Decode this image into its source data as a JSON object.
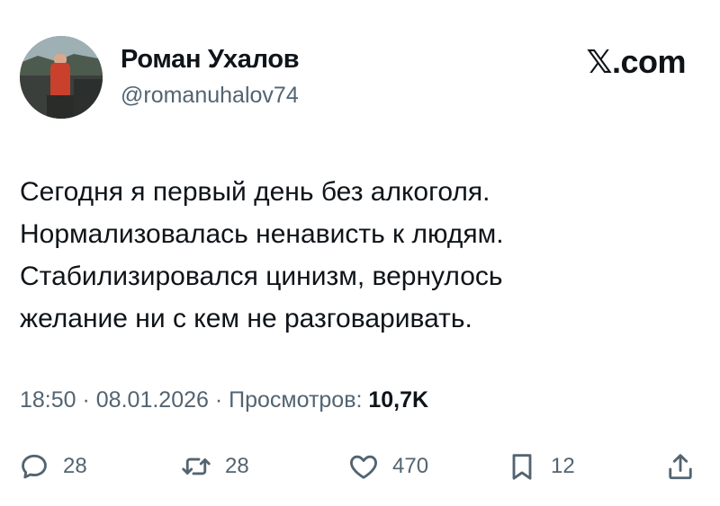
{
  "author": {
    "name": "Роман Ухалов",
    "handle": "@romanuhalov74"
  },
  "brand": "𝕏.com",
  "body_lines": [
    "Сегодня я первый день без алкоголя.",
    "Нормализовалась ненависть к людям.",
    "Стабилизировался цинизм, вернулось",
    "желание ни с кем не разговаривать."
  ],
  "meta": {
    "time": "18:50",
    "sep1": " · ",
    "date": "08.01.2026",
    "sep2": " · ",
    "views_label": "Просмотров: ",
    "views_count": "10,7K"
  },
  "actions": {
    "replies": "28",
    "reposts": "28",
    "likes": "470",
    "bookmarks": "12"
  },
  "icons": [
    "reply-icon",
    "repost-icon",
    "like-icon",
    "bookmark-icon",
    "share-icon"
  ],
  "colors": {
    "text": "#0f1419",
    "secondary": "#536471",
    "background": "#ffffff"
  }
}
